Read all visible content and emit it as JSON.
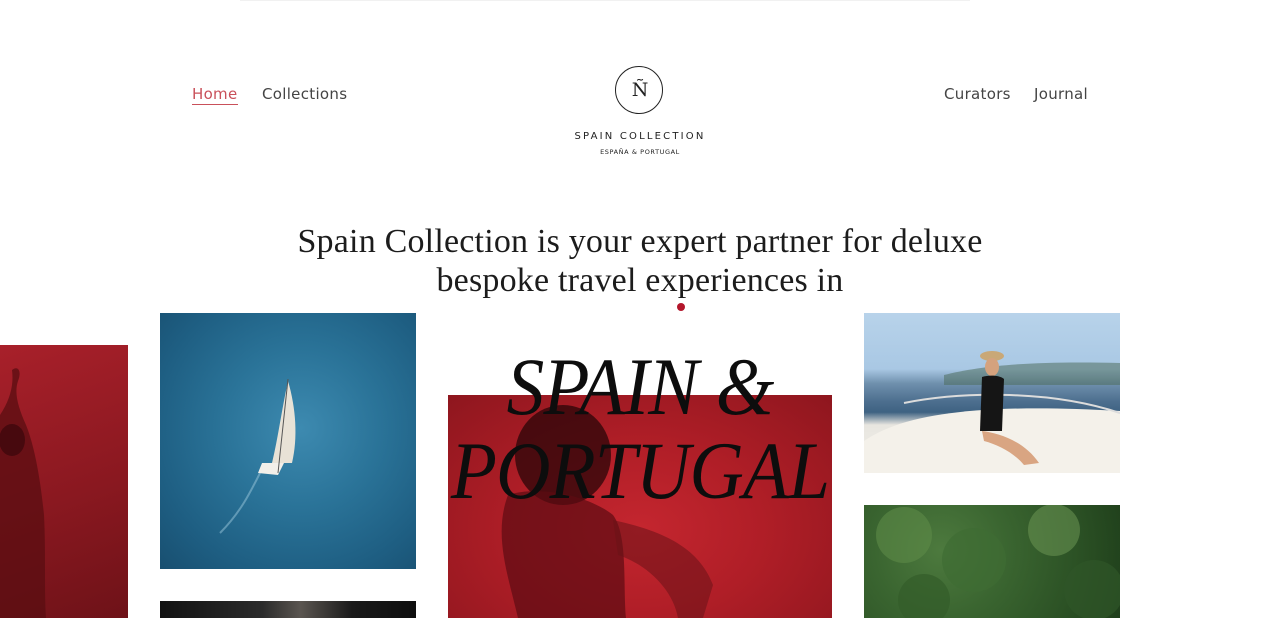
{
  "nav": {
    "left": [
      {
        "label": "Home",
        "active": true
      },
      {
        "label": "Collections",
        "active": false
      }
    ],
    "right": [
      {
        "label": "Curators"
      },
      {
        "label": "Journal"
      }
    ]
  },
  "logo": {
    "glyph": "Ñ",
    "name": "SPAIN COLLECTION",
    "subtitle": "ESPAÑA & PORTUGAL"
  },
  "hero": {
    "headline_line1": "Spain Collection is your expert partner for deluxe",
    "headline_line2": "bespoke travel experiences in",
    "title_line1": "SPAIN &",
    "title_line2": "PORTUGAL"
  },
  "colors": {
    "accent": "#c9505a",
    "dot": "#b3162b",
    "brand_red": "#b01e27",
    "text": "#1c1c1c"
  }
}
